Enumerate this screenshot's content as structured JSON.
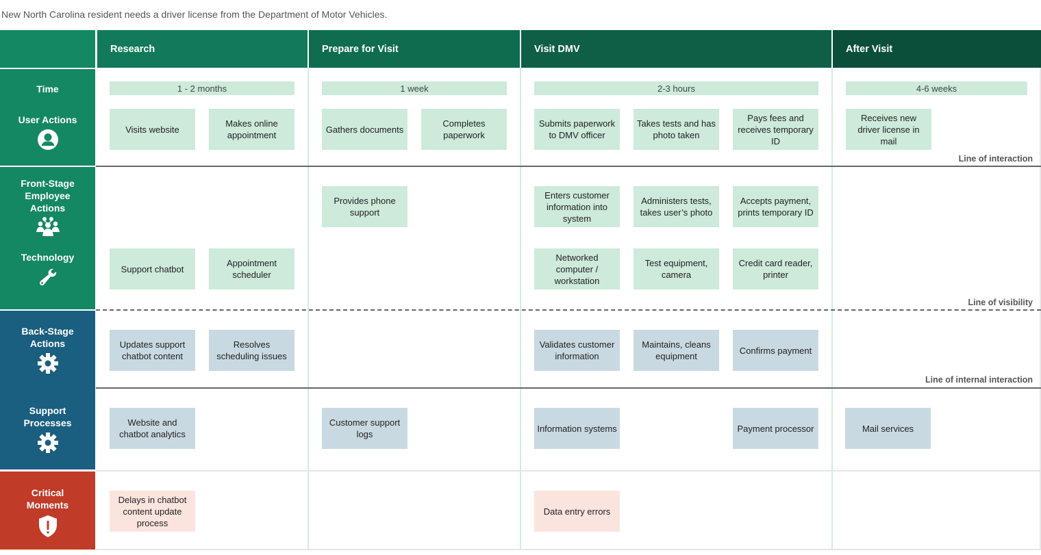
{
  "subtitle": "New North Carolina resident needs a driver license from the Department of Motor Vehicles.",
  "colors": {
    "header_green": "#127a5a",
    "header_dark": "#0b4f3b",
    "label_green": "#148763",
    "label_blue": "#1a5e80",
    "label_red": "#c03b28",
    "card_green": "#cdeadb",
    "card_blue": "#c9d9e1",
    "card_red": "#fce4de"
  },
  "phases": [
    {
      "label": "Research"
    },
    {
      "label": "Prepare for Visit"
    },
    {
      "label": "Visit DMV"
    },
    {
      "label": "After Visit"
    }
  ],
  "rows": {
    "time": {
      "label": "Time"
    },
    "user_actions": {
      "label": "User Actions",
      "icon": "user-icon"
    },
    "front_stage": {
      "label": "Front-Stage Employee Actions",
      "icon": "group-icon"
    },
    "technology": {
      "label": "Technology",
      "icon": "wrench-icon"
    },
    "back_stage": {
      "label": "Back-Stage Actions",
      "icon": "gear-icon"
    },
    "support": {
      "label": "Support Processes",
      "icon": "gear-icon"
    },
    "critical": {
      "label": "Critical Moments",
      "icon": "shield-alert-icon"
    }
  },
  "time": [
    "1 - 2 months",
    "1 week",
    "2-3 hours",
    "4-6 weeks"
  ],
  "lines": {
    "interaction": "Line of interaction",
    "visibility": "Line of visibility",
    "internal": "Line of internal interaction"
  },
  "cards": {
    "user_actions": [
      "Visits website",
      "Makes online appointment",
      "Gathers documents",
      "Completes paperwork",
      "Submits paperwork to DMV officer",
      "Takes tests and has photo taken",
      "Pays fees and receives temporary ID",
      "Receives new driver license in mail"
    ],
    "front_stage": [
      "Provides phone support",
      "Enters customer information into system",
      "Administers tests, takes user’s photo",
      "Accepts payment, prints temporary ID"
    ],
    "technology": [
      "Support chatbot",
      "Appointment scheduler",
      "Networked computer / workstation",
      "Test equipment, camera",
      "Credit card reader, printer"
    ],
    "back_stage": [
      "Updates support chatbot content",
      "Resolves scheduling issues",
      "Validates customer information",
      "Maintains, cleans equipment",
      "Confirms payment"
    ],
    "support": [
      "Website and chatbot analytics",
      "Customer support logs",
      "Information systems",
      "Payment processor",
      "Mail services"
    ],
    "critical": [
      "Delays in chatbot content update process",
      "Data entry errors"
    ]
  }
}
